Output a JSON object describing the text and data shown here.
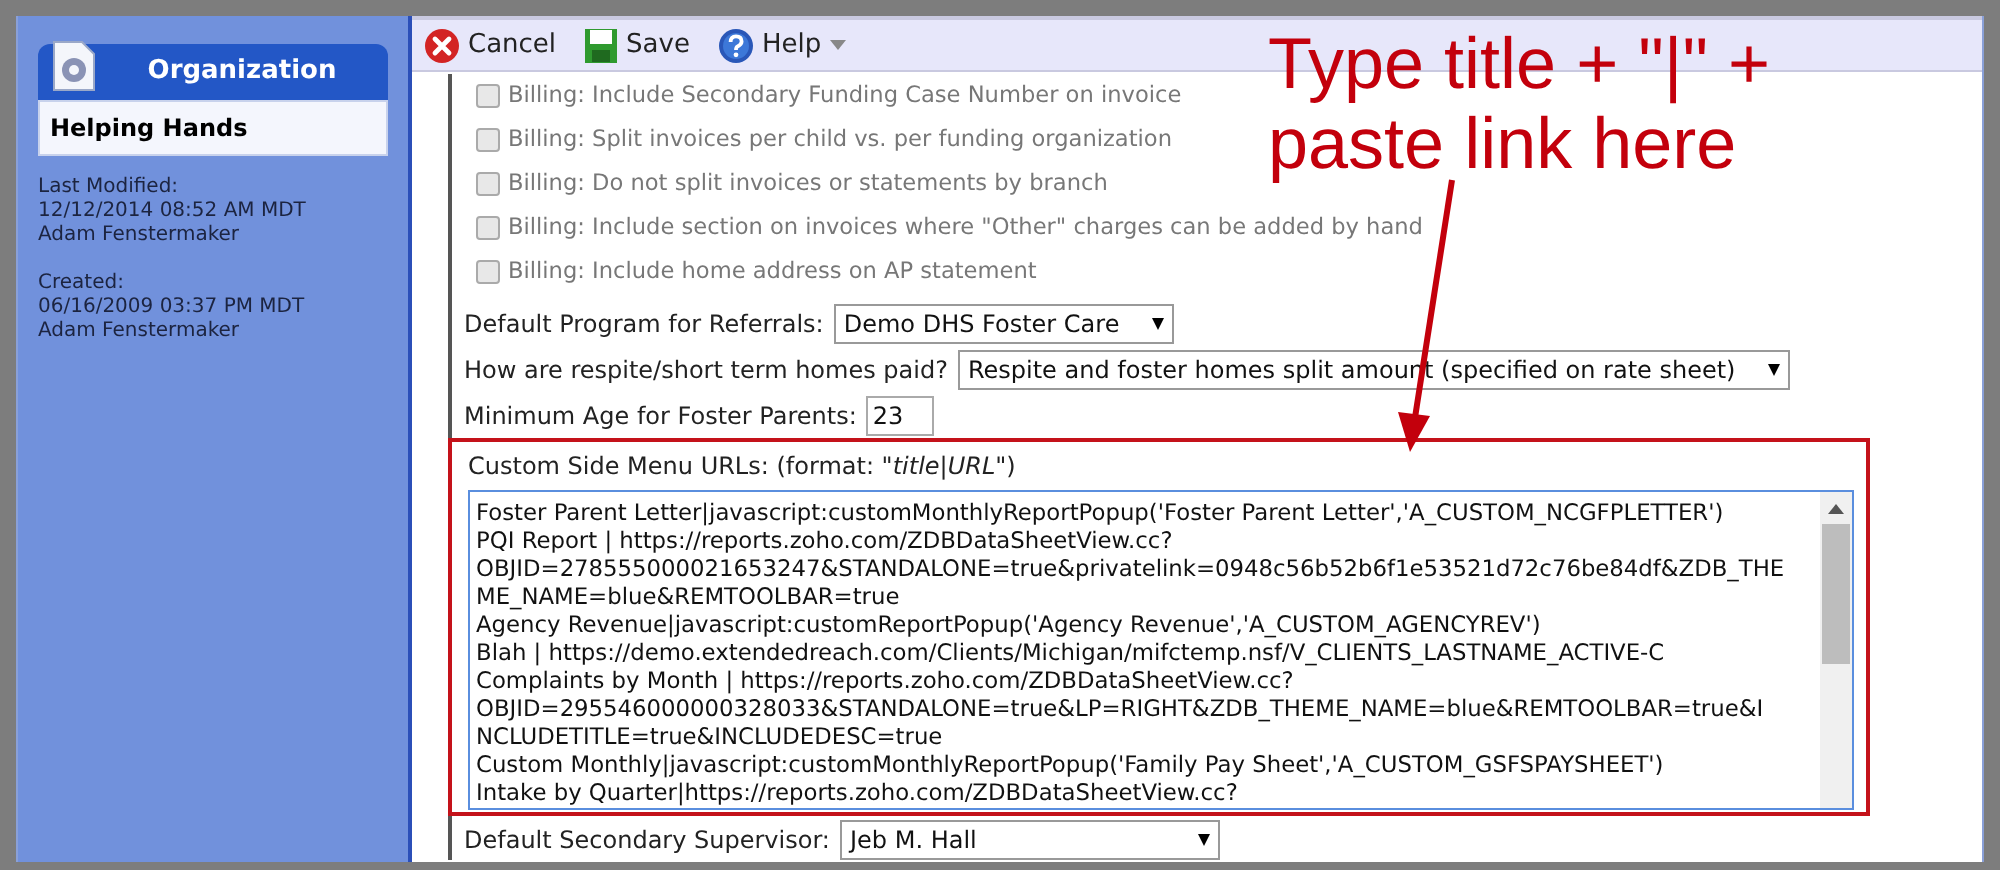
{
  "sidebar": {
    "title": "Organization",
    "name": "Helping Hands",
    "meta": [
      {
        "label": "Last Modified:",
        "date": "12/12/2014 08:52 AM MDT",
        "user": "Adam Fenstermaker"
      },
      {
        "label": "Created:",
        "date": "06/16/2009 03:37 PM MDT",
        "user": "Adam Fenstermaker"
      }
    ]
  },
  "toolbar": [
    {
      "kind": "cancel",
      "label": "Cancel"
    },
    {
      "kind": "save",
      "label": "Save"
    },
    {
      "kind": "help",
      "label": "Help"
    }
  ],
  "options": [
    {
      "label": "Billing: Include Secondary Funding Case Number on invoice",
      "checked": false
    },
    {
      "label": "Billing: Split invoices per child vs. per funding organization",
      "checked": false
    },
    {
      "label": "Billing: Do not split invoices or statements by branch",
      "checked": false
    },
    {
      "label": "Billing: Include section on invoices where \"Other\" charges can be added by hand",
      "checked": false
    },
    {
      "label": "Billing: Include home address on AP statement",
      "checked": false
    }
  ],
  "fields": [
    {
      "kind": "select",
      "label": "Default Program for Referrals:",
      "value": "Demo DHS Foster Care"
    },
    {
      "kind": "select",
      "label": "How are respite/short term homes paid?",
      "value": "Respite and foster homes split amount (specified on rate sheet)"
    },
    {
      "kind": "input",
      "label": "Minimum Age for Foster Parents:",
      "value": "23"
    }
  ],
  "custom_urls": {
    "label": "Custom Side Menu URLs: (format: \"*title*|*URL*\")",
    "lines": [
      "Foster Parent Letter|javascript:customMonthlyReportPopup('Foster Parent Letter','A_CUSTOM_NCGFPLETTER')",
      "PQI Report | https://reports.zoho.com/ZDBDataSheetView.cc?",
      "OBJID=278555000021653247&STANDALONE=true&privatelink=0948c56b52b6f1e53521d72c76be84df&ZDB_THE",
      "ME_NAME=blue&REMTOOLBAR=true",
      "Agency Revenue|javascript:customReportPopup('Agency Revenue','A_CUSTOM_AGENCYREV')",
      "Blah | https://demo.extendedreach.com/Clients/Michigan/mifctemp.nsf/V_CLIENTS_LASTNAME_ACTIVE-C",
      "Complaints by Month | https://reports.zoho.com/ZDBDataSheetView.cc?",
      "OBJID=295546000000328033&STANDALONE=true&LP=RIGHT&ZDB_THEME_NAME=blue&REMTOOLBAR=true&I",
      "NCLUDETITLE=true&INCLUDEDESC=true",
      "Custom Monthly|javascript:customMonthlyReportPopup('Family Pay Sheet','A_CUSTOM_GSFSPAYSHEET')",
      "Intake by Quarter|https://reports.zoho.com/ZDBDataSheetView.cc?"
    ]
  },
  "bottom_field": {
    "label": "Default Secondary Supervisor:",
    "value": "Jeb M. Hall"
  },
  "annotation": {
    "lines": [
      "Type title + \"|\" +",
      "paste link here"
    ]
  }
}
